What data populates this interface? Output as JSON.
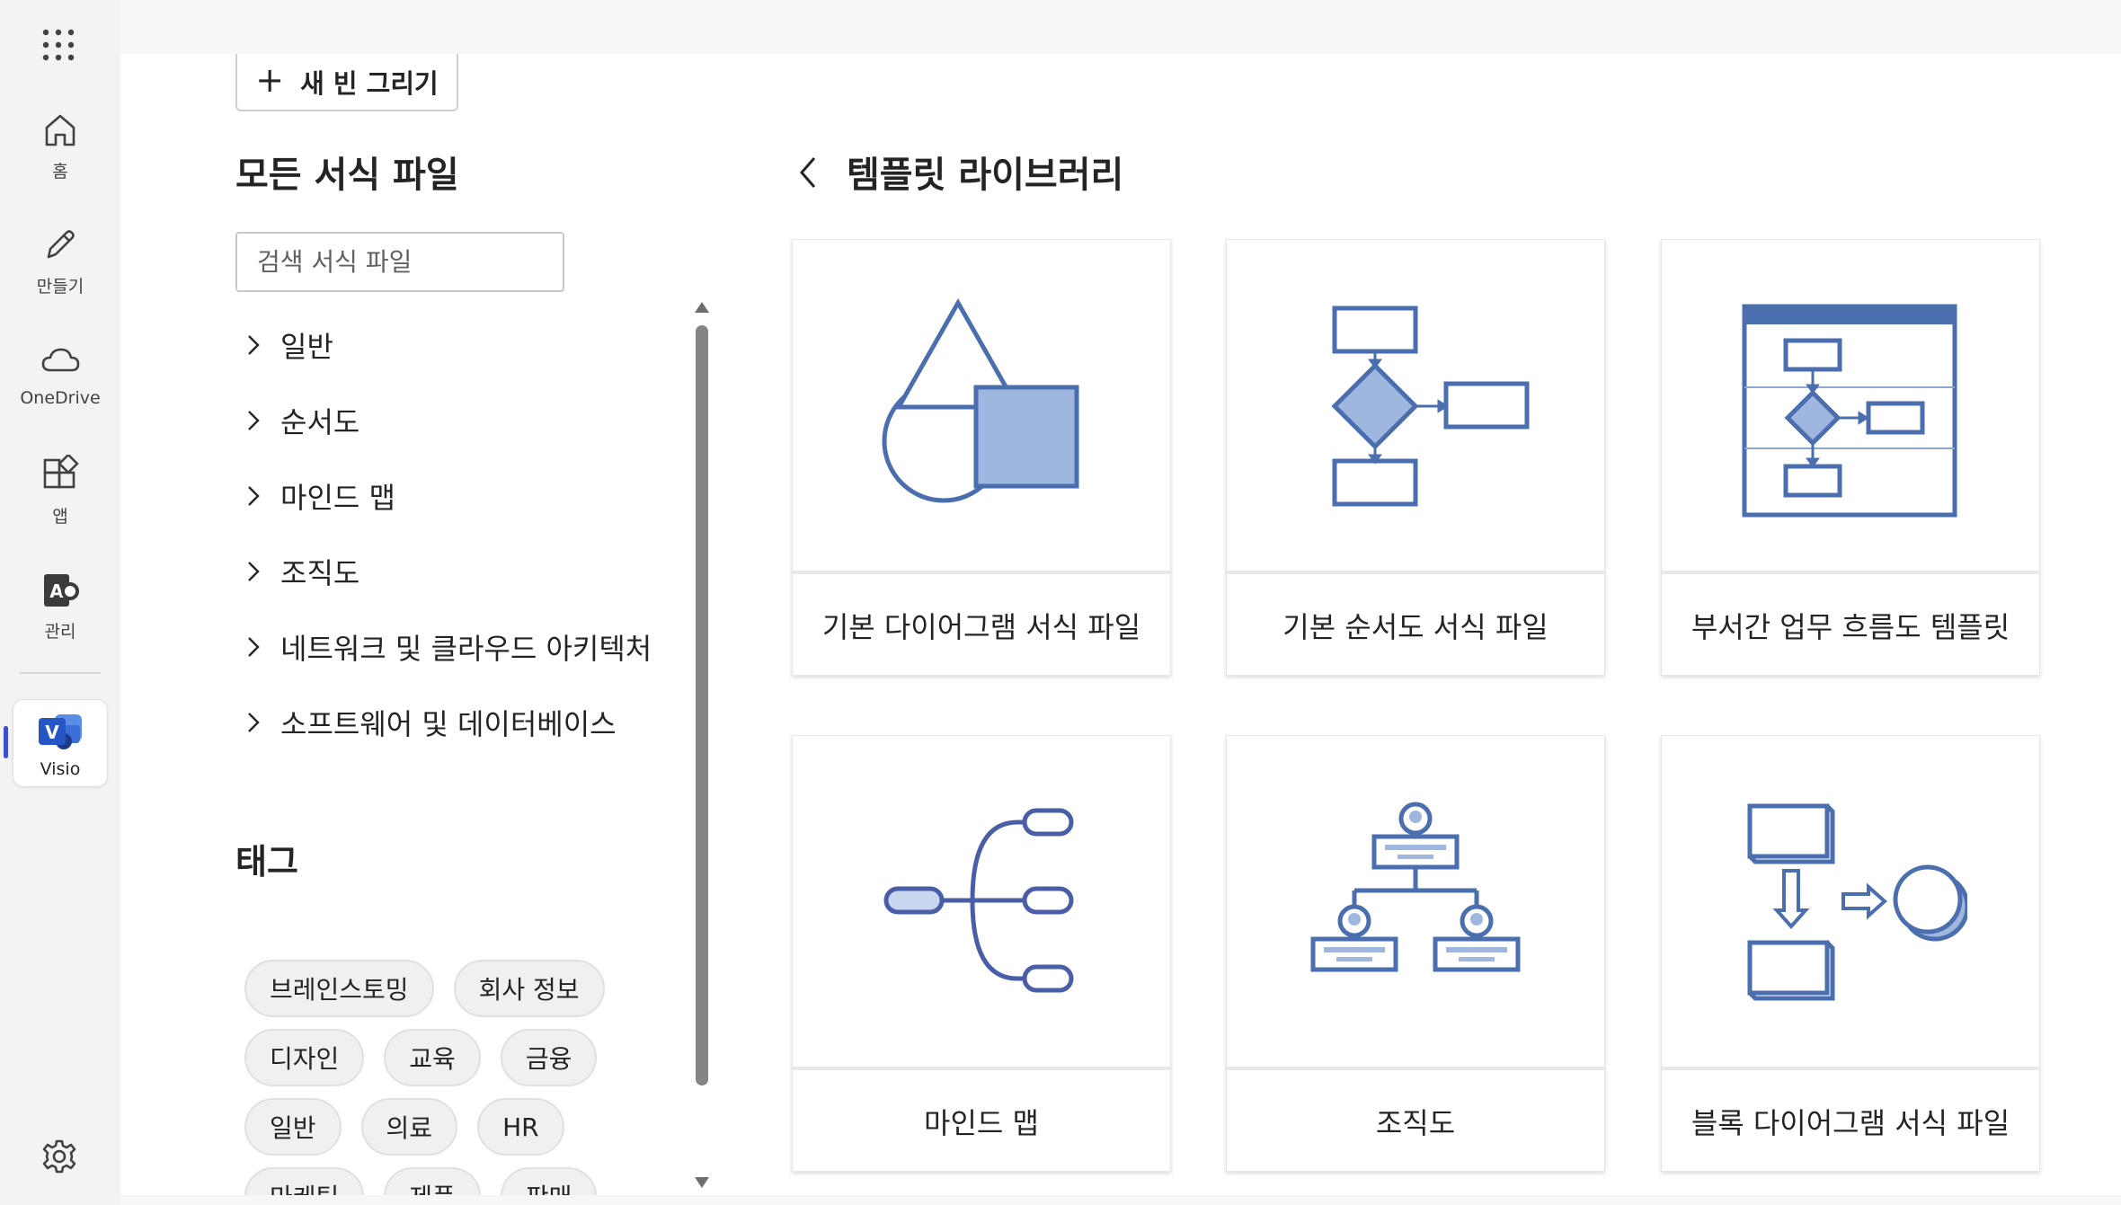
{
  "rail": {
    "items": [
      {
        "label": "홈",
        "icon": "home-icon"
      },
      {
        "label": "만들기",
        "icon": "pencil-icon"
      },
      {
        "label": "OneDrive",
        "icon": "cloud-icon"
      },
      {
        "label": "앱",
        "icon": "apps-icon"
      },
      {
        "label": "관리",
        "icon": "admin-icon"
      }
    ],
    "active_app": {
      "label": "Visio",
      "icon": "visio-icon"
    }
  },
  "new_button": {
    "label": "새 빈 그리기"
  },
  "left": {
    "title": "모든 서식 파일",
    "search_placeholder": "검색 서식 파일",
    "categories": [
      "일반",
      "순서도",
      "마인드 맵",
      "조직도",
      "네트워크 및 클라우드 아키텍처",
      "소프트웨어 및 데이터베이스"
    ],
    "tags_title": "태그",
    "tags": [
      [
        "브레인스토밍",
        "회사 정보"
      ],
      [
        "디자인",
        "교육",
        "금융"
      ],
      [
        "일반",
        "의료",
        "HR"
      ],
      [
        "마케팅",
        "제품",
        "판매"
      ]
    ]
  },
  "library": {
    "title": "템플릿 라이브러리",
    "cards": [
      {
        "title": "기본 다이어그램 서식 파일"
      },
      {
        "title": "기본 순서도 서식 파일"
      },
      {
        "title": "부서간 업무 흐름도 템플릿"
      },
      {
        "title": "마인드 맵"
      },
      {
        "title": "조직도"
      },
      {
        "title": "블록 다이어그램 서식 파일"
      }
    ]
  },
  "colors": {
    "accent": "#3b4fd1",
    "shape_stroke": "#4a6eae",
    "shape_fill": "#9fb7df"
  }
}
